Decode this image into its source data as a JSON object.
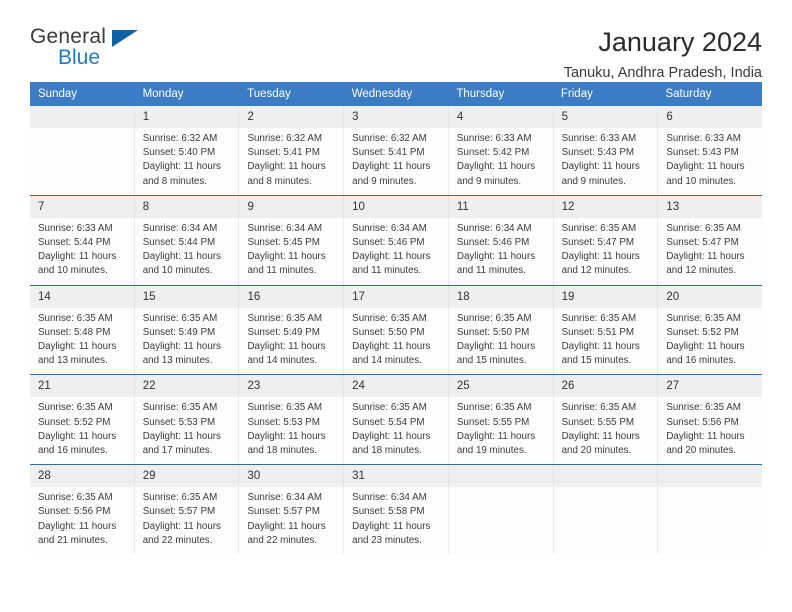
{
  "brand": {
    "name_part1": "General",
    "name_part2": "Blue",
    "logo_icon": "triangle-flag-icon",
    "accent_color": "#1f7ac4"
  },
  "header": {
    "title": "January 2024",
    "location": "Tanuku, Andhra Pradesh, India"
  },
  "theme": {
    "header_blue": "#3b7cc4",
    "row_divider_blue": "#2e6da8",
    "daynum_band": "#efefef"
  },
  "calendar": {
    "weekday_headers": [
      "Sunday",
      "Monday",
      "Tuesday",
      "Wednesday",
      "Thursday",
      "Friday",
      "Saturday"
    ],
    "weeks": [
      {
        "days": [
          {
            "num": "",
            "lines": []
          },
          {
            "num": "1",
            "lines": [
              "Sunrise: 6:32 AM",
              "Sunset: 5:40 PM",
              "Daylight: 11 hours",
              "and 8 minutes."
            ]
          },
          {
            "num": "2",
            "lines": [
              "Sunrise: 6:32 AM",
              "Sunset: 5:41 PM",
              "Daylight: 11 hours",
              "and 8 minutes."
            ]
          },
          {
            "num": "3",
            "lines": [
              "Sunrise: 6:32 AM",
              "Sunset: 5:41 PM",
              "Daylight: 11 hours",
              "and 9 minutes."
            ]
          },
          {
            "num": "4",
            "lines": [
              "Sunrise: 6:33 AM",
              "Sunset: 5:42 PM",
              "Daylight: 11 hours",
              "and 9 minutes."
            ]
          },
          {
            "num": "5",
            "lines": [
              "Sunrise: 6:33 AM",
              "Sunset: 5:43 PM",
              "Daylight: 11 hours",
              "and 9 minutes."
            ]
          },
          {
            "num": "6",
            "lines": [
              "Sunrise: 6:33 AM",
              "Sunset: 5:43 PM",
              "Daylight: 11 hours",
              "and 10 minutes."
            ]
          }
        ]
      },
      {
        "days": [
          {
            "num": "7",
            "lines": [
              "Sunrise: 6:33 AM",
              "Sunset: 5:44 PM",
              "Daylight: 11 hours",
              "and 10 minutes."
            ]
          },
          {
            "num": "8",
            "lines": [
              "Sunrise: 6:34 AM",
              "Sunset: 5:44 PM",
              "Daylight: 11 hours",
              "and 10 minutes."
            ]
          },
          {
            "num": "9",
            "lines": [
              "Sunrise: 6:34 AM",
              "Sunset: 5:45 PM",
              "Daylight: 11 hours",
              "and 11 minutes."
            ]
          },
          {
            "num": "10",
            "lines": [
              "Sunrise: 6:34 AM",
              "Sunset: 5:46 PM",
              "Daylight: 11 hours",
              "and 11 minutes."
            ]
          },
          {
            "num": "11",
            "lines": [
              "Sunrise: 6:34 AM",
              "Sunset: 5:46 PM",
              "Daylight: 11 hours",
              "and 11 minutes."
            ]
          },
          {
            "num": "12",
            "lines": [
              "Sunrise: 6:35 AM",
              "Sunset: 5:47 PM",
              "Daylight: 11 hours",
              "and 12 minutes."
            ]
          },
          {
            "num": "13",
            "lines": [
              "Sunrise: 6:35 AM",
              "Sunset: 5:47 PM",
              "Daylight: 11 hours",
              "and 12 minutes."
            ]
          }
        ]
      },
      {
        "days": [
          {
            "num": "14",
            "lines": [
              "Sunrise: 6:35 AM",
              "Sunset: 5:48 PM",
              "Daylight: 11 hours",
              "and 13 minutes."
            ]
          },
          {
            "num": "15",
            "lines": [
              "Sunrise: 6:35 AM",
              "Sunset: 5:49 PM",
              "Daylight: 11 hours",
              "and 13 minutes."
            ]
          },
          {
            "num": "16",
            "lines": [
              "Sunrise: 6:35 AM",
              "Sunset: 5:49 PM",
              "Daylight: 11 hours",
              "and 14 minutes."
            ]
          },
          {
            "num": "17",
            "lines": [
              "Sunrise: 6:35 AM",
              "Sunset: 5:50 PM",
              "Daylight: 11 hours",
              "and 14 minutes."
            ]
          },
          {
            "num": "18",
            "lines": [
              "Sunrise: 6:35 AM",
              "Sunset: 5:50 PM",
              "Daylight: 11 hours",
              "and 15 minutes."
            ]
          },
          {
            "num": "19",
            "lines": [
              "Sunrise: 6:35 AM",
              "Sunset: 5:51 PM",
              "Daylight: 11 hours",
              "and 15 minutes."
            ]
          },
          {
            "num": "20",
            "lines": [
              "Sunrise: 6:35 AM",
              "Sunset: 5:52 PM",
              "Daylight: 11 hours",
              "and 16 minutes."
            ]
          }
        ]
      },
      {
        "days": [
          {
            "num": "21",
            "lines": [
              "Sunrise: 6:35 AM",
              "Sunset: 5:52 PM",
              "Daylight: 11 hours",
              "and 16 minutes."
            ]
          },
          {
            "num": "22",
            "lines": [
              "Sunrise: 6:35 AM",
              "Sunset: 5:53 PM",
              "Daylight: 11 hours",
              "and 17 minutes."
            ]
          },
          {
            "num": "23",
            "lines": [
              "Sunrise: 6:35 AM",
              "Sunset: 5:53 PM",
              "Daylight: 11 hours",
              "and 18 minutes."
            ]
          },
          {
            "num": "24",
            "lines": [
              "Sunrise: 6:35 AM",
              "Sunset: 5:54 PM",
              "Daylight: 11 hours",
              "and 18 minutes."
            ]
          },
          {
            "num": "25",
            "lines": [
              "Sunrise: 6:35 AM",
              "Sunset: 5:55 PM",
              "Daylight: 11 hours",
              "and 19 minutes."
            ]
          },
          {
            "num": "26",
            "lines": [
              "Sunrise: 6:35 AM",
              "Sunset: 5:55 PM",
              "Daylight: 11 hours",
              "and 20 minutes."
            ]
          },
          {
            "num": "27",
            "lines": [
              "Sunrise: 6:35 AM",
              "Sunset: 5:56 PM",
              "Daylight: 11 hours",
              "and 20 minutes."
            ]
          }
        ]
      },
      {
        "days": [
          {
            "num": "28",
            "lines": [
              "Sunrise: 6:35 AM",
              "Sunset: 5:56 PM",
              "Daylight: 11 hours",
              "and 21 minutes."
            ]
          },
          {
            "num": "29",
            "lines": [
              "Sunrise: 6:35 AM",
              "Sunset: 5:57 PM",
              "Daylight: 11 hours",
              "and 22 minutes."
            ]
          },
          {
            "num": "30",
            "lines": [
              "Sunrise: 6:34 AM",
              "Sunset: 5:57 PM",
              "Daylight: 11 hours",
              "and 22 minutes."
            ]
          },
          {
            "num": "31",
            "lines": [
              "Sunrise: 6:34 AM",
              "Sunset: 5:58 PM",
              "Daylight: 11 hours",
              "and 23 minutes."
            ]
          },
          {
            "num": "",
            "lines": []
          },
          {
            "num": "",
            "lines": []
          },
          {
            "num": "",
            "lines": []
          }
        ]
      }
    ]
  }
}
